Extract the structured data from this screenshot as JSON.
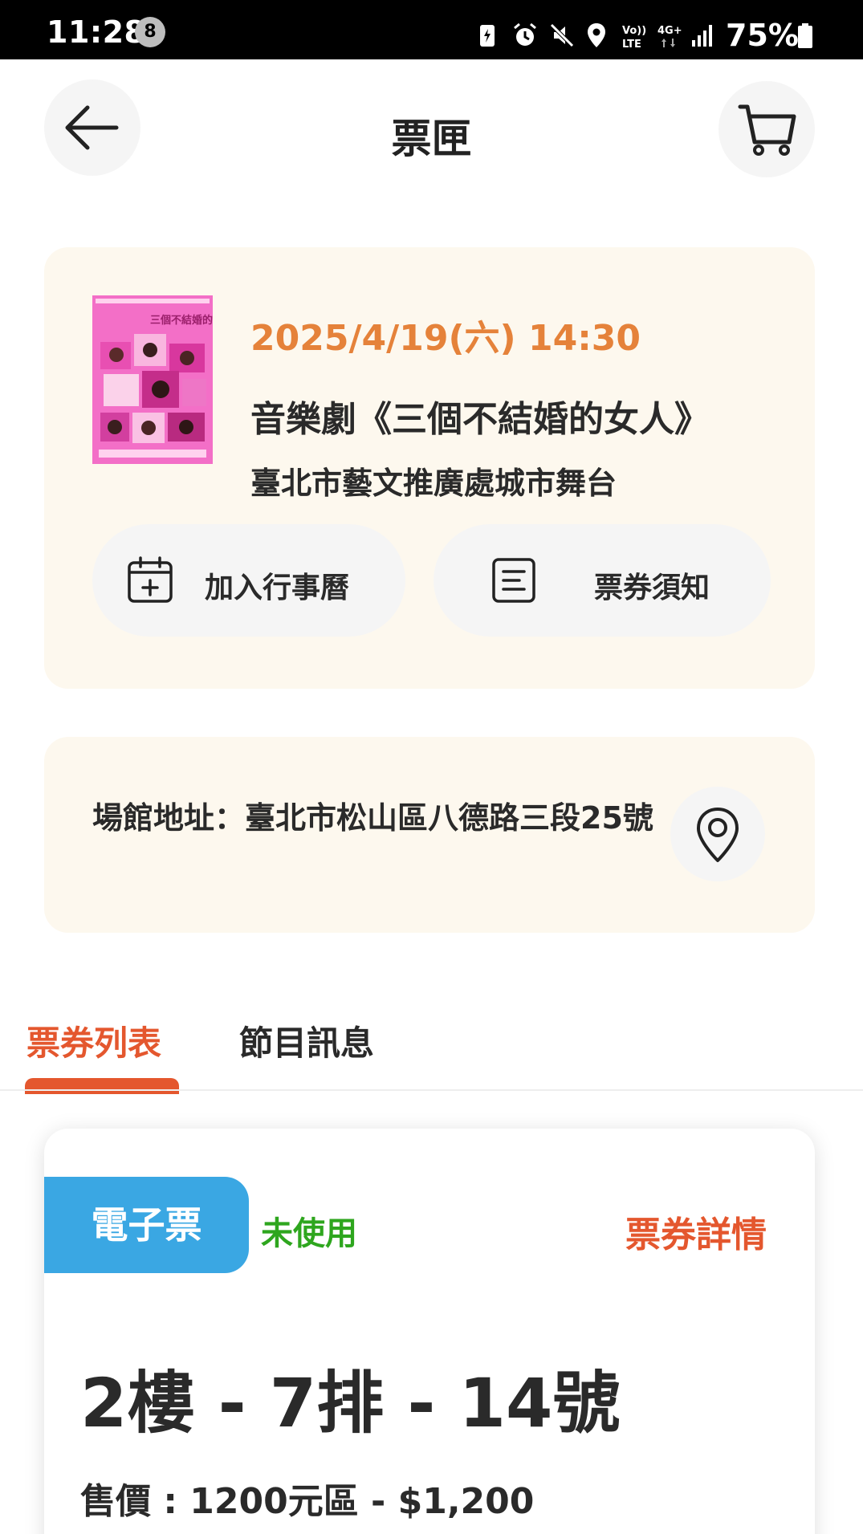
{
  "status_bar": {
    "time": "11:28",
    "notification_count": "8",
    "battery_percent": "75%",
    "icons": [
      "battery-saver-icon",
      "alarm-icon",
      "mute-icon",
      "location-icon",
      "volte-icon",
      "4g-icon",
      "signal-icon",
      "battery-icon"
    ]
  },
  "header": {
    "title": "票匣",
    "back_icon": "arrow-left-icon",
    "cart_icon": "cart-icon"
  },
  "event": {
    "datetime": "2025/4/19(六) 14:30",
    "title": "音樂劇《三個不結婚的女人》",
    "venue": "臺北市藝文推廣處城市舞台",
    "poster_title": "三個不結婚的女人",
    "add_calendar_label": "加入行事曆",
    "ticket_notice_label": "票券須知"
  },
  "address": {
    "text": "場館地址：臺北市松山區八德路三段25號"
  },
  "tabs": [
    {
      "label": "票券列表",
      "active": true
    },
    {
      "label": "節目訊息",
      "active": false
    }
  ],
  "ticket": {
    "type_badge": "電子票",
    "status": "未使用",
    "detail_link": "票券詳情",
    "seat": "2樓 - 7排 - 14號",
    "price": "售價 : 1200元區 - $1,200"
  },
  "colors": {
    "accent_orange": "#e5823a",
    "accent_red": "#e4572e",
    "card_bg": "#fdf8ee",
    "eticket_blue": "#3aa7e3",
    "status_green": "#2ea61e"
  }
}
